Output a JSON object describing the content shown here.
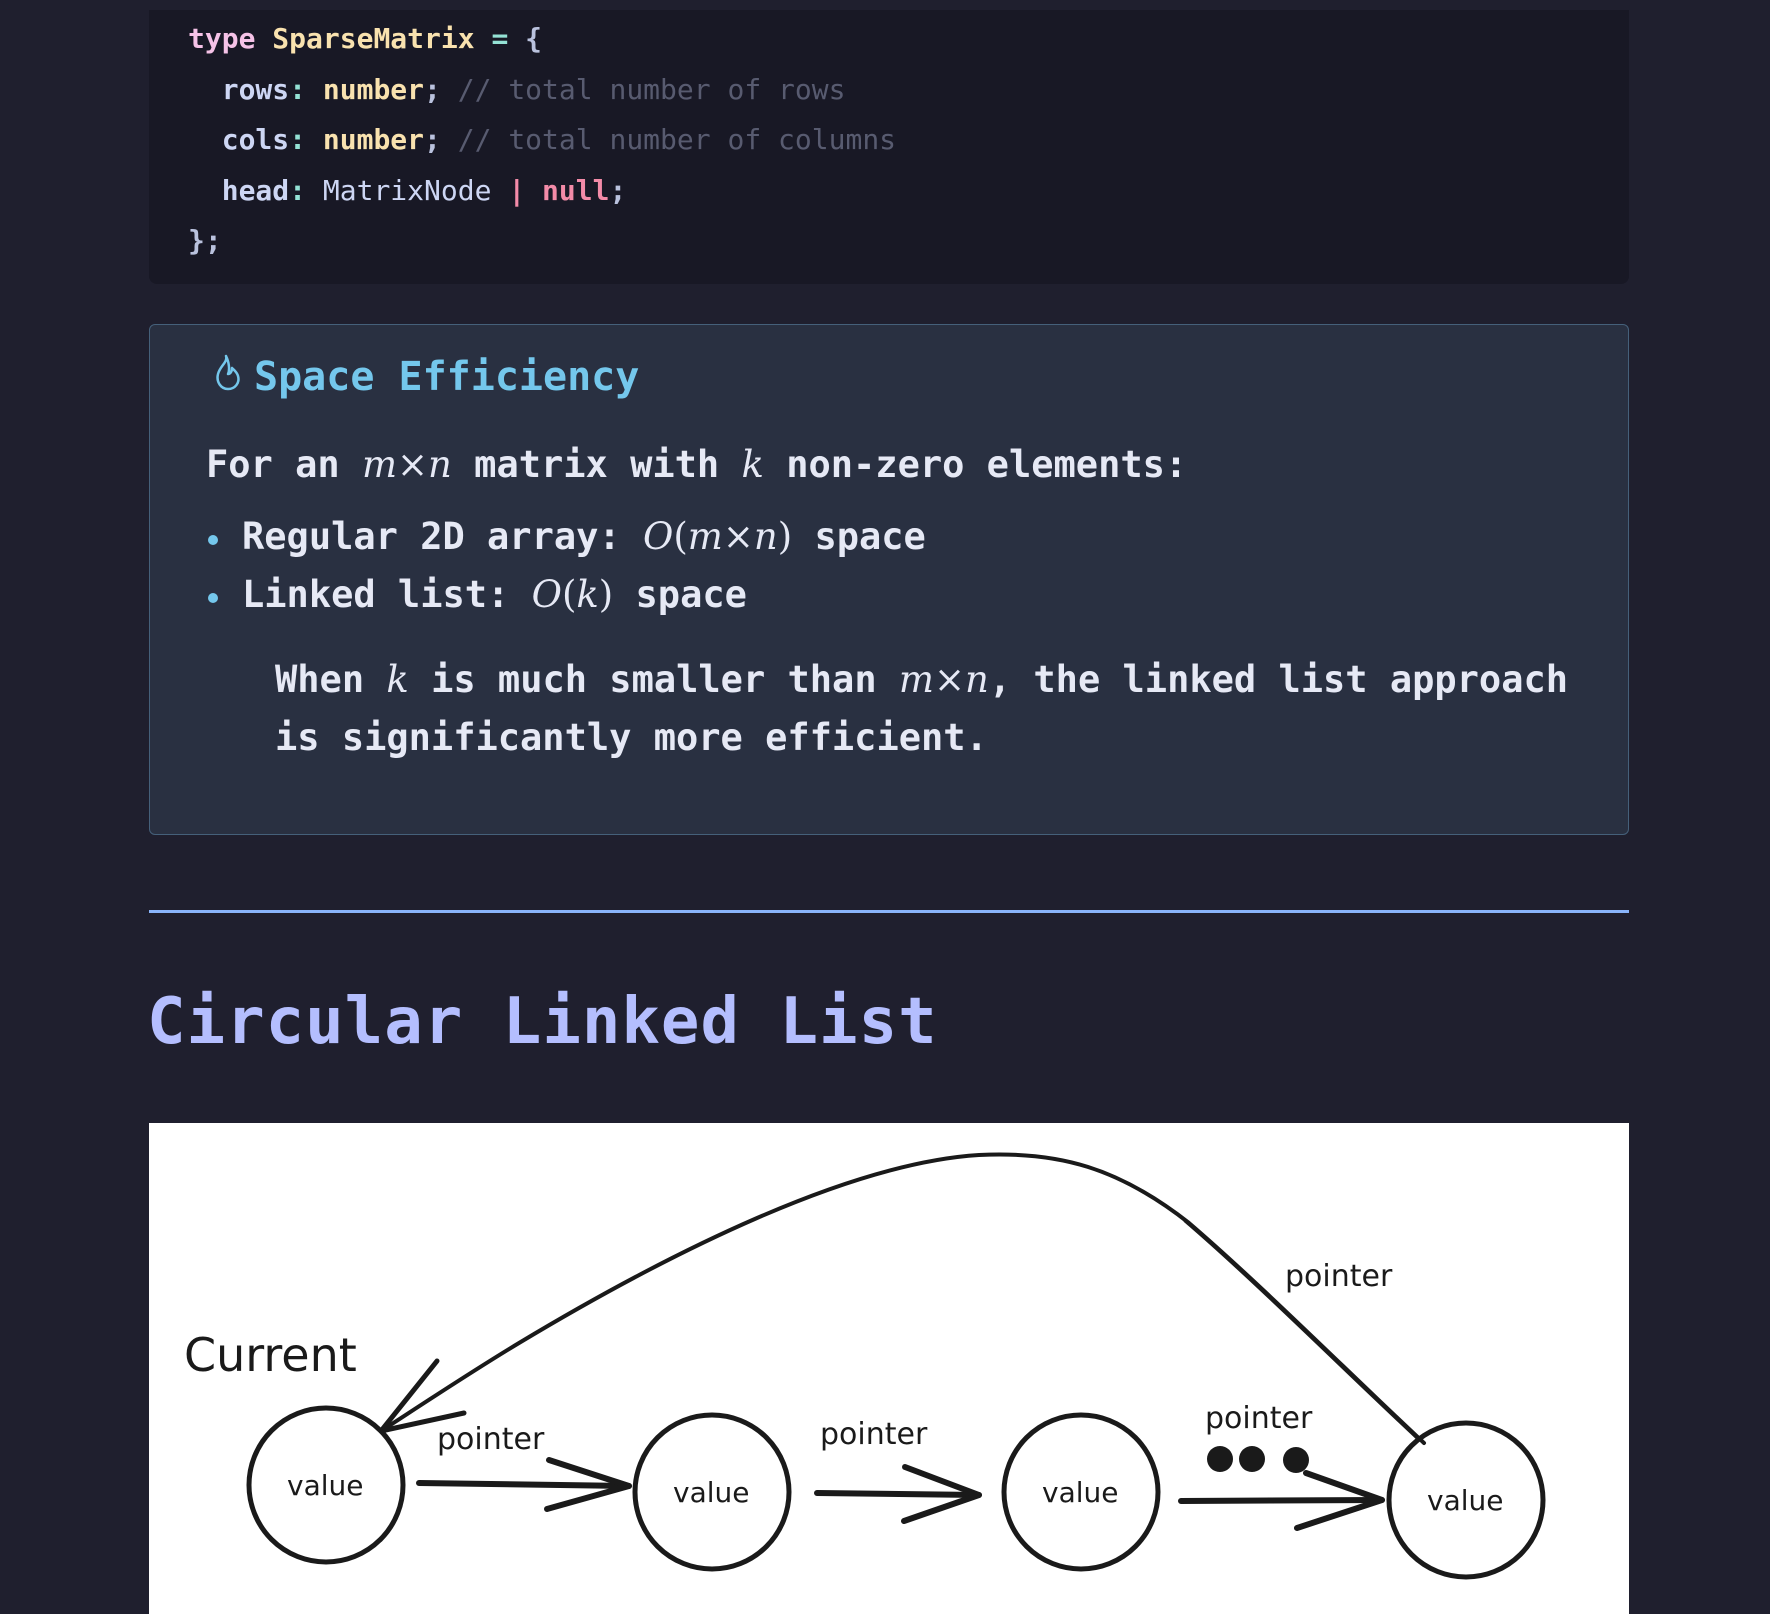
{
  "code": {
    "type_keyword": "type",
    "type_name": "SparseMatrix",
    "equals": "=",
    "open_brace": "{",
    "close_brace": "};",
    "fields": [
      {
        "name": "rows",
        "type": "number",
        "comment": "// total number of rows"
      },
      {
        "name": "cols",
        "type": "number",
        "comment": "// total number of columns"
      },
      {
        "name": "head",
        "type": "MatrixNode",
        "union": "|",
        "null_type": "null"
      }
    ]
  },
  "callout": {
    "title": "Space Efficiency",
    "icon": "flame-icon",
    "intro": {
      "prefix": "For an",
      "math_m": "m",
      "times": "×",
      "math_n": "n",
      "middle": "matrix with",
      "math_k": "k",
      "suffix": "non-zero elements:"
    },
    "bullets": [
      {
        "label": "Regular 2D array:",
        "complexity_O": "O",
        "complexity_open": "(",
        "complexity_inner_m": "m",
        "complexity_times": "×",
        "complexity_inner_n": "n",
        "complexity_close": ")",
        "suffix": "space"
      },
      {
        "label": "Linked list:",
        "complexity_O": "O",
        "complexity_open": "(",
        "complexity_inner": "k",
        "complexity_close": ")",
        "suffix": "space"
      }
    ],
    "note": {
      "prefix": "When",
      "math_k": "k",
      "middle": "is much smaller than",
      "math_m": "m",
      "times": "×",
      "math_n": "n",
      "suffix": ", the linked list approach is significantly more efficient."
    }
  },
  "section": {
    "heading": "Circular Linked List"
  },
  "diagram": {
    "current_label": "Current",
    "node_label": "value",
    "pointer_label": "pointer"
  },
  "colors": {
    "background": "#1f1f2e",
    "code_background": "#181825",
    "callout_background": "#293041",
    "callout_accent": "#74c7ec",
    "divider": "#89b4fa",
    "heading": "#b4befe"
  }
}
